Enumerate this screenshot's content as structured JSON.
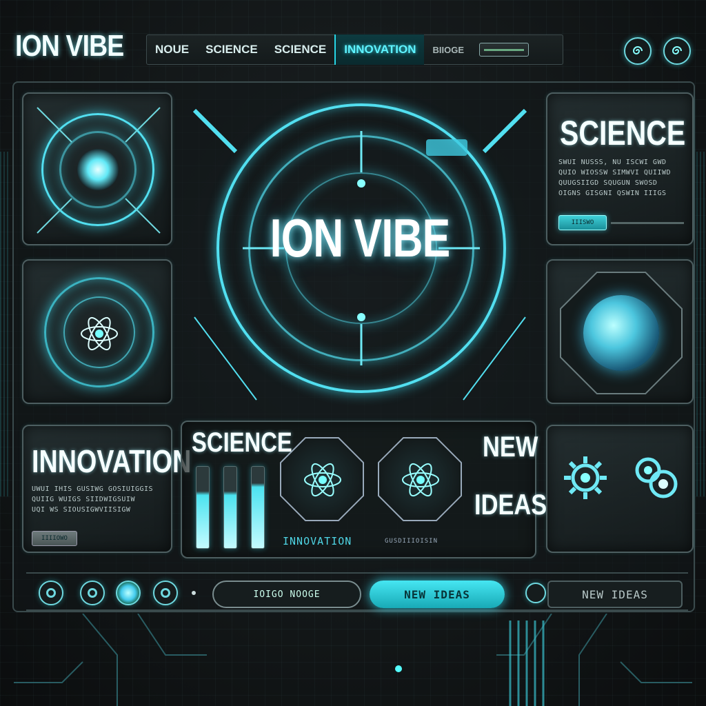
{
  "brand": {
    "logo": "ION VIBE"
  },
  "nav": {
    "items": [
      {
        "label": "NOUE",
        "active": false
      },
      {
        "label": "SCIENCE",
        "active": false
      },
      {
        "label": "SCIENCE",
        "active": false
      },
      {
        "label": "INNOVATION",
        "active": true
      },
      {
        "label": "BIIOGE",
        "active": false
      }
    ]
  },
  "hero": {
    "title": "ION VIBE"
  },
  "science_card": {
    "title": "SCIENCE",
    "lines": [
      "SWUI NUSSS, NU ISCWI GWD",
      "QUIO WIOSSW SIMWVI QUIIWD",
      "QUUGSIIGD SQUGUN SWOSD",
      "OIGNS GISGNI QSWIN IIIGS"
    ],
    "button": "IIISWO"
  },
  "innovation_card": {
    "title": "INNOVATION",
    "lines": [
      "UWUI IHIS GUSIWG GOSIUIGGIS",
      "QUIIG WUIGS SIIDWIGSUIW",
      "UQI WS SIOUSIGWVIISIGW"
    ],
    "button": "IIIIOWO"
  },
  "strip": {
    "science_label": "SCIENCE",
    "innovation_label": "INNOVATION",
    "caption": "GUSDIIIOISIN",
    "new_label": "NEW",
    "ideas_label": "IDEAS",
    "bar_levels": [
      0.7,
      0.7,
      0.8
    ]
  },
  "footer": {
    "outline_button": "IOIGO NOOGE",
    "primary_button": "NEW IDEAS",
    "ghost_button": "NEW IDEAS"
  },
  "colors": {
    "accent": "#52dff0",
    "accent_bright": "#5ff3ff",
    "panel_border": "#4d5e60",
    "background": "#121617"
  },
  "icons": [
    "spiral-icon",
    "target-icon",
    "atom-icon",
    "globe-icon",
    "gear-icon"
  ]
}
